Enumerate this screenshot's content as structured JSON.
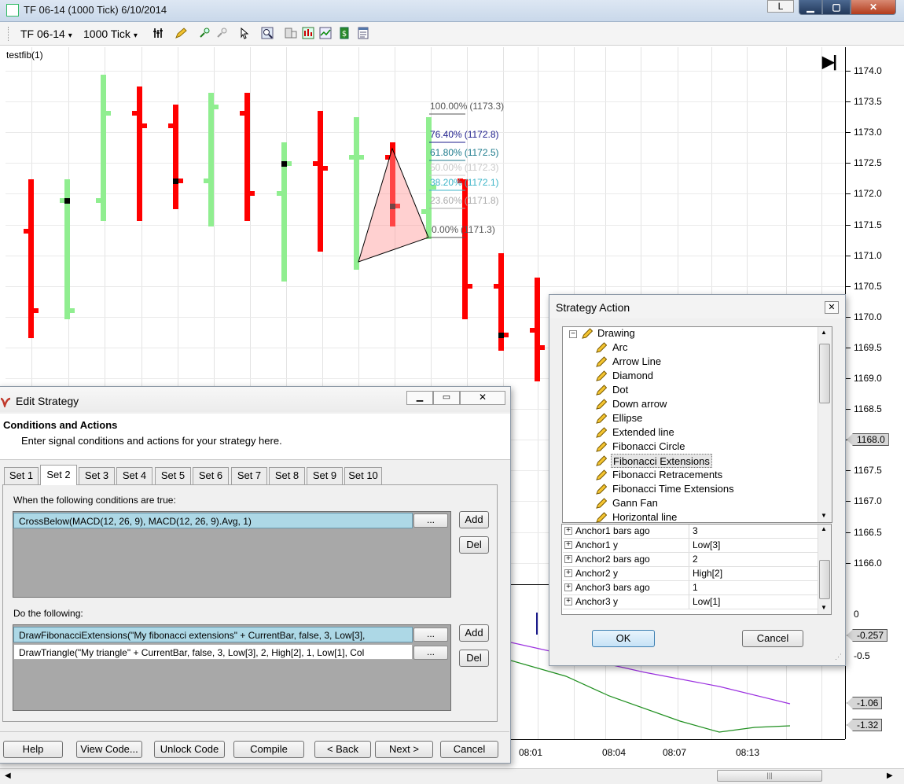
{
  "window": {
    "title": "TF 06-14 (1000 Tick)  6/10/2014",
    "l_button": "L",
    "min_glyph": "▁",
    "max_glyph": "▢",
    "close_glyph": "✕"
  },
  "toolbar": {
    "instrument": "TF 06-14",
    "period": "1000 Tick",
    "dropdown_glyph": "▾"
  },
  "chart": {
    "strategy_label": "testfib(1)",
    "end_glyph": "▶|",
    "price_labels": [
      "1174.0",
      "1173.5",
      "1173.0",
      "1172.5",
      "1172.0",
      "1171.5",
      "1171.0",
      "1170.5",
      "1170.0",
      "1169.5",
      "1169.0",
      "1168.5",
      "1168.0",
      "1167.5",
      "1167.0",
      "1166.5",
      "1166.0"
    ],
    "price_tag": "1168.0",
    "fib_levels": [
      {
        "pct": "100.00%",
        "price": "(1173.3)",
        "color": "#555555"
      },
      {
        "pct": "76.40%",
        "price": "(1172.8)",
        "color": "#1e1e8c"
      },
      {
        "pct": "61.80%",
        "price": "(1172.5)",
        "color": "#1c7a8c"
      },
      {
        "pct": "50.00%",
        "price": "(1172.3)",
        "color": "#c8c8c8"
      },
      {
        "pct": "38.20%",
        "price": "(1172.1)",
        "color": "#3cb4c8"
      },
      {
        "pct": "23.60%",
        "price": "(1171.8)",
        "color": "#aaaaaa"
      },
      {
        "pct": "0.00%",
        "price": "(1171.3)",
        "color": "#555555"
      }
    ],
    "bar_colors": {
      "up": "#90ee90",
      "down": "#ff0000"
    },
    "indicator": {
      "labels": [
        "0",
        "-0.5"
      ],
      "tags": [
        "-0.257",
        "-1.06",
        "-1.32"
      ]
    },
    "time_labels": [
      "08:01",
      "08:04",
      "08:07",
      "08:13"
    ]
  },
  "edit_strategy": {
    "title": "Edit Strategy",
    "heading": "Conditions and Actions",
    "subheading": "Enter signal conditions and actions for your strategy here.",
    "tabs": [
      "Set 1",
      "Set 2",
      "Set 3",
      "Set 4",
      "Set 5",
      "Set 6",
      "Set 7",
      "Set 8",
      "Set 9",
      "Set 10"
    ],
    "active_tab": "Set 2",
    "conditions_label": "When the following conditions are true:",
    "conditions": [
      "CrossBelow(MACD(12, 26, 9), MACD(12, 26, 9).Avg, 1)"
    ],
    "actions_label": "Do the following:",
    "actions": [
      "DrawFibonacciExtensions(\"My fibonacci extensions\" + CurrentBar, false, 3, Low[3],",
      "DrawTriangle(\"My triangle\" + CurrentBar, false, 3, Low[3], 2, High[2], 1, Low[1], Col"
    ],
    "ellipsis": "...",
    "add": "Add",
    "del": "Del",
    "footer_buttons": [
      "Help",
      "View Code...",
      "Unlock Code",
      "Compile",
      "< Back",
      "Next >",
      "Cancel"
    ]
  },
  "strategy_action": {
    "title": "Strategy Action",
    "close_glyph": "✕",
    "root": "Drawing",
    "collapse_glyph": "−",
    "expand_glyph": "+",
    "items": [
      "Arc",
      "Arrow Line",
      "Diamond",
      "Dot",
      "Down arrow",
      "Ellipse",
      "Extended line",
      "Fibonacci Circle",
      "Fibonacci Extensions",
      "Fibonacci Retracements",
      "Fibonacci Time Extensions",
      "Gann Fan",
      "Horizontal line"
    ],
    "selected_item": "Fibonacci Extensions",
    "properties": [
      {
        "name": "Anchor1 bars ago",
        "value": "3"
      },
      {
        "name": "Anchor1 y",
        "value": "Low[3]"
      },
      {
        "name": "Anchor2 bars ago",
        "value": "2"
      },
      {
        "name": "Anchor2 y",
        "value": "High[2]"
      },
      {
        "name": "Anchor3 bars ago",
        "value": "1"
      },
      {
        "name": "Anchor3 y",
        "value": "Low[1]"
      }
    ],
    "ok": "OK",
    "cancel": "Cancel"
  }
}
